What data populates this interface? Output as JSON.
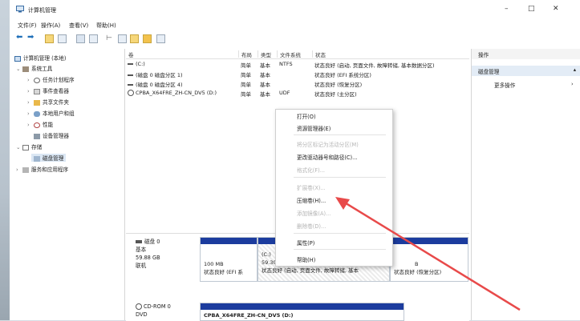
{
  "window": {
    "title": "计算机管理"
  },
  "window_controls": {
    "minimize": "–",
    "maximize": "□",
    "close": "✕"
  },
  "menubar": {
    "items": [
      "文件(F)",
      "操作(A)",
      "查看(V)",
      "帮助(H)"
    ]
  },
  "toolbar": {
    "back": "⬅",
    "forward": "➡"
  },
  "tree": {
    "root": "计算机管理 (本地)",
    "system_tools": "系统工具",
    "task_scheduler": "任务计划程序",
    "event_viewer": "事件查看器",
    "shared_folders": "共享文件夹",
    "local_users": "本地用户和组",
    "performance": "性能",
    "device_manager": "设备管理器",
    "storage": "存储",
    "disk_management": "磁盘管理",
    "services": "服务和应用程序"
  },
  "volume_list": {
    "columns": [
      "卷",
      "布局",
      "类型",
      "文件系统",
      "状态"
    ],
    "rows": [
      {
        "volume": "(C:)",
        "layout": "简单",
        "type": "基本",
        "fs": "NTFS",
        "status": "状态良好 (启动, 页面文件, 故障转储, 基本数据分区)"
      },
      {
        "volume": "(磁盘 0 磁盘分区 1)",
        "layout": "简单",
        "type": "基本",
        "fs": "",
        "status": "状态良好 (EFI 系统分区)"
      },
      {
        "volume": "(磁盘 0 磁盘分区 4)",
        "layout": "简单",
        "type": "基本",
        "fs": "",
        "status": "状态良好 (恢复分区)"
      },
      {
        "volume": "CPBA_X64FRE_ZH-CN_DV5 (D:)",
        "layout": "简单",
        "type": "基本",
        "fs": "UDF",
        "status": "状态良好 (主分区)"
      }
    ]
  },
  "disk_graph": {
    "disk0": {
      "name": "磁盘 0",
      "type": "基本",
      "size": "59.88 GB",
      "state": "联机"
    },
    "partitions": [
      {
        "size": "100 MB",
        "status": "状态良好 (EFI 系"
      },
      {
        "label": "(C:)",
        "size": "59.30 G",
        "status": "状态良好 (启动, 页面文件, 故障转储, 基本"
      },
      {
        "size": "B",
        "status": "状态良好 (恢复分区)"
      }
    ],
    "cdrom": {
      "name": "CD-ROM 0",
      "type": "DVD",
      "volume": "CPBA_X64FRE_ZH-CN_DV5 (D:)"
    }
  },
  "actions": {
    "header": "操作",
    "section": "磁盘管理",
    "more": "更多操作"
  },
  "context_menu": {
    "items": [
      {
        "label": "打开(O)",
        "enabled": true
      },
      {
        "label": "资源管理器(E)",
        "enabled": true
      },
      {
        "label": "将分区标记为活动分区(M)",
        "enabled": false
      },
      {
        "label": "更改驱动器号和路径(C)...",
        "enabled": true
      },
      {
        "label": "格式化(F)...",
        "enabled": false
      },
      {
        "label": "扩展卷(X)...",
        "enabled": false
      },
      {
        "label": "压缩卷(H)...",
        "enabled": true
      },
      {
        "label": "添加镜像(A)...",
        "enabled": false
      },
      {
        "label": "删除卷(D)...",
        "enabled": false
      },
      {
        "label": "属性(P)",
        "enabled": true
      },
      {
        "label": "帮助(H)",
        "enabled": true
      }
    ]
  },
  "colors": {
    "partition_bar": "#1c3c9e",
    "arrow": "#e84a4a",
    "selection": "#dbe7f4"
  }
}
